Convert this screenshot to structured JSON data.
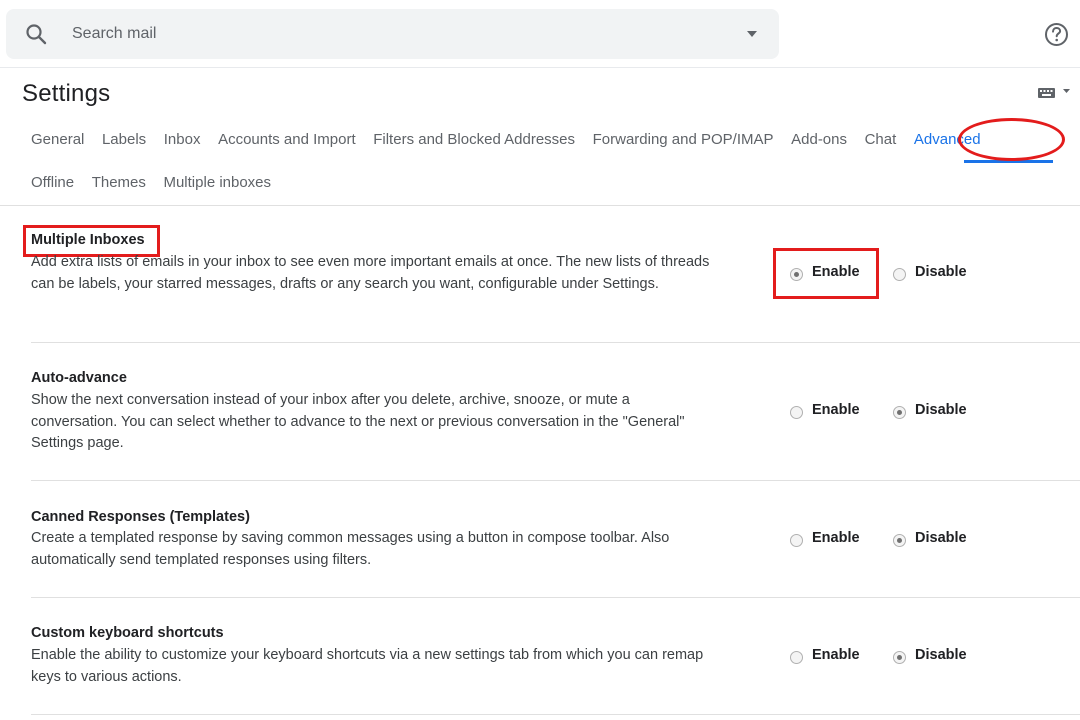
{
  "search": {
    "placeholder": "Search mail",
    "icon": "search-icon"
  },
  "header": {
    "title": "Settings"
  },
  "tabs": {
    "row1": [
      {
        "label": "General"
      },
      {
        "label": "Labels"
      },
      {
        "label": "Inbox"
      },
      {
        "label": "Accounts and Import"
      },
      {
        "label": "Filters and Blocked Addresses"
      },
      {
        "label": "Forwarding and POP/IMAP"
      },
      {
        "label": "Add-ons"
      },
      {
        "label": "Chat"
      },
      {
        "label": "Advanced",
        "active": true
      }
    ],
    "row2": [
      {
        "label": "Offline"
      },
      {
        "label": "Themes"
      },
      {
        "label": "Multiple inboxes"
      }
    ]
  },
  "settings": [
    {
      "title": "Multiple Inboxes",
      "description": "Add extra lists of emails in your inbox to see even more important emails at once. The new lists of threads can be labels, your starred messages, drafts or any search you want, configurable under Settings.",
      "enable_label": "Enable",
      "disable_label": "Disable",
      "selected": "Enable"
    },
    {
      "title": "Auto-advance",
      "description": "Show the next conversation instead of your inbox after you delete, archive, snooze, or mute a conversation. You can select whether to advance to the next or previous conversation in the \"General\" Settings page.",
      "enable_label": "Enable",
      "disable_label": "Disable",
      "selected": "Disable"
    },
    {
      "title": "Canned Responses (Templates)",
      "description": "Create a templated response by saving common messages using a button in compose toolbar. Also automatically send templated responses using filters.",
      "enable_label": "Enable",
      "disable_label": "Disable",
      "selected": "Disable"
    },
    {
      "title": "Custom keyboard shortcuts",
      "description": "Enable the ability to customize your keyboard shortcuts via a new settings tab from which you can remap keys to various actions.",
      "enable_label": "Enable",
      "disable_label": "Disable",
      "selected": "Disable"
    }
  ],
  "colors": {
    "accent": "#1a73e8",
    "annotation": "#e31c1c",
    "searchbar_bg": "#f1f3f4",
    "text": "#202124",
    "muted_text": "#5f6368"
  }
}
